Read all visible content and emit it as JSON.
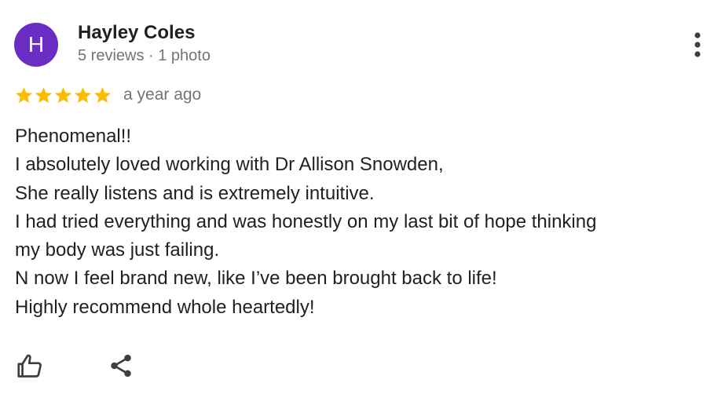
{
  "author": {
    "initial": "H",
    "name": "Hayley Coles",
    "meta": "5 reviews · 1 photo",
    "avatar_color": "#6a2cc2"
  },
  "review": {
    "rating": 5,
    "rating_max": 5,
    "star_color": "#fbbc04",
    "date": "a year ago",
    "lines": [
      "Phenomenal!!",
      "I absolutely loved working with Dr Allison Snowden,",
      "She really listens and is extremely intuitive.",
      "I had tried everything and was honestly on my last bit of hope thinking",
      "my body was just failing.",
      "N now I feel brand new, like I’ve been brought back to life!",
      "Highly recommend whole heartedly!"
    ]
  },
  "actions": {
    "more_icon": "more-vert-icon",
    "like_icon": "thumb-up-icon",
    "share_icon": "share-icon"
  }
}
